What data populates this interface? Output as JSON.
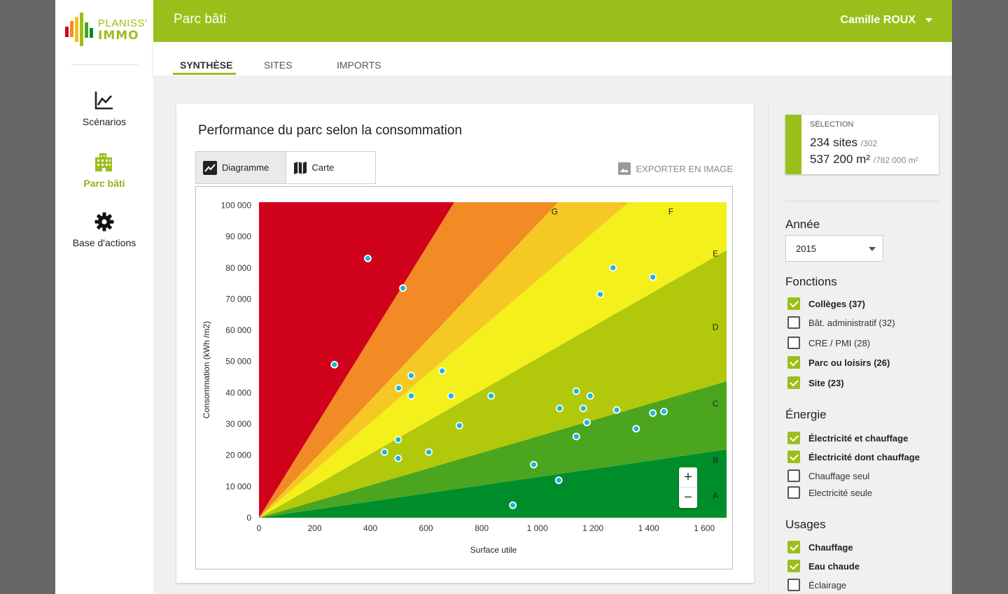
{
  "brand": {
    "line1": "PLANISS'",
    "line2": "IMMO"
  },
  "nav": [
    {
      "label": "Scénarios",
      "icon": "chart-line-icon"
    },
    {
      "label": "Parc bâti",
      "icon": "building-icon",
      "active": true
    },
    {
      "label": "Base d'actions",
      "icon": "gear-icon"
    }
  ],
  "header": {
    "title": "Parc bâti",
    "user": "Camille ROUX"
  },
  "tabs": [
    "SYNTHÈSE",
    "SITES",
    "IMPORTS"
  ],
  "card": {
    "title": "Performance du parc selon la consommation",
    "toggle": [
      "Diagramme",
      "Carte"
    ],
    "export_label": "EXPORTER EN IMAGE"
  },
  "selection": {
    "label": "SÉLECTION",
    "sites": "234 sites",
    "sites_total": "/302",
    "area": "537 200 m²",
    "area_total": "/782 000 m²"
  },
  "filters": {
    "annee_title": "Année",
    "annee_value": "2015",
    "fonctions_title": "Fonctions",
    "fonctions": [
      {
        "label": "Collèges (37)",
        "checked": true
      },
      {
        "label": "Bât. administratif (32)",
        "checked": false
      },
      {
        "label": "CRE / PMI (28)",
        "checked": false
      },
      {
        "label": "Parc ou loisirs (26)",
        "checked": true
      },
      {
        "label": "Site (23)",
        "checked": true
      }
    ],
    "energie_title": "Énergie",
    "energie": [
      {
        "label": "Électricité et chauffage",
        "checked": true
      },
      {
        "label": "Électricité dont chauffage",
        "checked": true
      },
      {
        "label": "Chauffage seul",
        "checked": false
      },
      {
        "label": "Electricité seule",
        "checked": false
      }
    ],
    "usages_title": "Usages",
    "usages": [
      {
        "label": "Chauffage",
        "checked": true
      },
      {
        "label": "Eau chaude",
        "checked": true
      },
      {
        "label": "Éclairage",
        "checked": false
      }
    ]
  },
  "colors": {
    "accent": "#9bbf1a",
    "point": "#1ab6d9"
  },
  "chart_data": {
    "type": "scatter",
    "xlabel": "Surface utile",
    "ylabel": "Consommation (kWh /m2)",
    "xlim": [
      0,
      1680
    ],
    "ylim": [
      0,
      101000
    ],
    "x_ticks": [
      0,
      200,
      400,
      600,
      800,
      1000,
      1200,
      1400,
      1600
    ],
    "x_tick_labels": [
      "0",
      "200",
      "400",
      "600",
      "800",
      "1 000",
      "1 200",
      "1 400",
      "1 600"
    ],
    "y_ticks": [
      0,
      10000,
      20000,
      30000,
      40000,
      50000,
      60000,
      70000,
      80000,
      90000,
      100000
    ],
    "y_tick_labels": [
      "0",
      "10  000",
      "20 000",
      "30 000",
      "40 000",
      "50 000",
      "60 000",
      "70 000",
      "80 000",
      "90 000",
      "100 000"
    ],
    "zones": [
      {
        "label": "A",
        "slope_to": 13,
        "color": "#008e2c"
      },
      {
        "label": "B",
        "slope_to": 26,
        "color": "#4ba51f"
      },
      {
        "label": "C",
        "slope_to": 51,
        "color": "#b1c90a"
      },
      {
        "label": "D",
        "slope_to": 76,
        "color": "#f3f01c"
      },
      {
        "label": "E",
        "slope_to": 94,
        "color": "#f6c823"
      },
      {
        "label": "F",
        "slope_to": 144,
        "color": "#f28a25"
      },
      {
        "label": "G",
        "slope_to": null,
        "color": "#d0021b"
      }
    ],
    "points": [
      [
        271,
        49000
      ],
      [
        391,
        83000
      ],
      [
        517,
        73500
      ],
      [
        502,
        41500
      ],
      [
        547,
        45500
      ],
      [
        547,
        39000
      ],
      [
        658,
        47000
      ],
      [
        690,
        39000
      ],
      [
        720,
        29500
      ],
      [
        834,
        39000
      ],
      [
        451,
        21000
      ],
      [
        500,
        25000
      ],
      [
        500,
        19000
      ],
      [
        610,
        21000
      ],
      [
        987,
        17000
      ],
      [
        1077,
        12000
      ],
      [
        912,
        4000
      ],
      [
        1140,
        40500
      ],
      [
        1165,
        35000
      ],
      [
        1190,
        39000
      ],
      [
        1226,
        71500
      ],
      [
        1272,
        80000
      ],
      [
        1285,
        34500
      ],
      [
        1415,
        77000
      ],
      [
        1355,
        28500
      ],
      [
        1455,
        34000
      ],
      [
        1415,
        33500
      ],
      [
        1178,
        30500
      ],
      [
        1140,
        26000
      ],
      [
        1080,
        35000
      ]
    ]
  }
}
